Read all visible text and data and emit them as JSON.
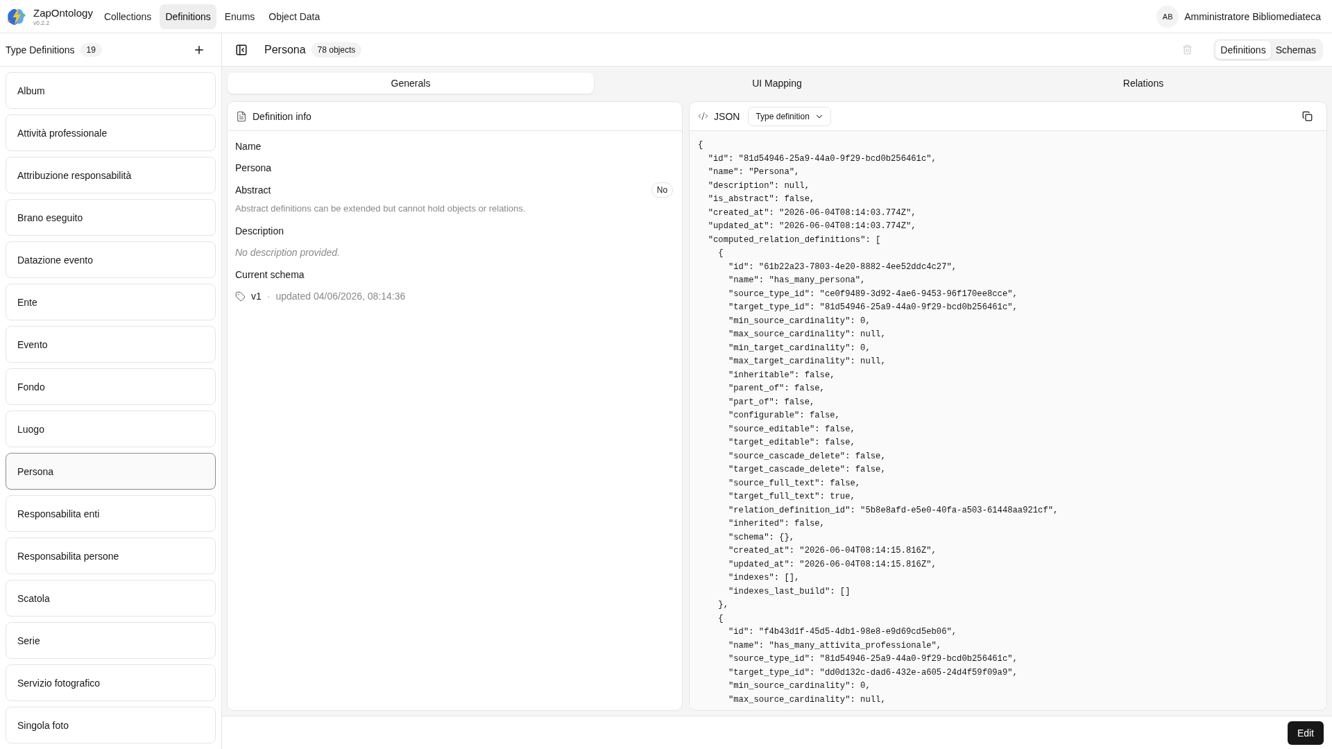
{
  "header": {
    "app_name": "ZapOntology",
    "version": "v0.2.2",
    "nav": [
      {
        "label": "Collections",
        "selected": false
      },
      {
        "label": "Definitions",
        "selected": true
      },
      {
        "label": "Enums",
        "selected": false
      },
      {
        "label": "Object Data",
        "selected": false
      }
    ],
    "user": {
      "initials": "AB",
      "name": "Amministratore Bibliomediateca"
    }
  },
  "sidebar": {
    "title": "Type Definitions",
    "count": "19",
    "items": [
      {
        "label": "Album",
        "selected": false
      },
      {
        "label": "Attività professionale",
        "selected": false
      },
      {
        "label": "Attribuzione responsabilità",
        "selected": false
      },
      {
        "label": "Brano eseguito",
        "selected": false
      },
      {
        "label": "Datazione evento",
        "selected": false
      },
      {
        "label": "Ente",
        "selected": false
      },
      {
        "label": "Evento",
        "selected": false
      },
      {
        "label": "Fondo",
        "selected": false
      },
      {
        "label": "Luogo",
        "selected": false
      },
      {
        "label": "Persona",
        "selected": true
      },
      {
        "label": "Responsabilita enti",
        "selected": false
      },
      {
        "label": "Responsabilita persone",
        "selected": false
      },
      {
        "label": "Scatola",
        "selected": false
      },
      {
        "label": "Serie",
        "selected": false
      },
      {
        "label": "Servizio fotografico",
        "selected": false
      },
      {
        "label": "Singola foto",
        "selected": false
      }
    ]
  },
  "detail": {
    "title": "Persona",
    "object_count": "78 objects",
    "delete_disabled": true,
    "view_switch": [
      {
        "label": "Definitions",
        "selected": true
      },
      {
        "label": "Schemas",
        "selected": false
      }
    ],
    "tabs": [
      {
        "label": "Generals",
        "selected": true
      },
      {
        "label": "UI Mapping",
        "selected": false
      },
      {
        "label": "Relations",
        "selected": false
      }
    ]
  },
  "definition_info": {
    "title": "Definition info",
    "name_label": "Name",
    "name_value": "Persona",
    "abstract_label": "Abstract",
    "abstract_value": "No",
    "abstract_help": "Abstract definitions can be extended but cannot hold objects or relations.",
    "description_label": "Description",
    "description_empty": "No description provided.",
    "schema_label": "Current schema",
    "schema_version": "v1",
    "schema_separator": "·",
    "schema_updated": "updated 04/06/2026, 08:14:36"
  },
  "json_panel": {
    "title": "JSON",
    "format": "Type definition",
    "lines": [
      "{",
      "  \"id\": \"81d54946-25a9-44a0-9f29-bcd0b256461c\",",
      "  \"name\": \"Persona\",",
      "  \"description\": null,",
      "  \"is_abstract\": false,",
      "  \"created_at\": \"2026-06-04T08:14:03.774Z\",",
      "  \"updated_at\": \"2026-06-04T08:14:03.774Z\",",
      "  \"computed_relation_definitions\": [",
      "    {",
      "      \"id\": \"61b22a23-7803-4e20-8882-4ee52ddc4c27\",",
      "      \"name\": \"has_many_persona\",",
      "      \"source_type_id\": \"ce0f9489-3d92-4ae6-9453-96f170ee8cce\",",
      "      \"target_type_id\": \"81d54946-25a9-44a0-9f29-bcd0b256461c\",",
      "      \"min_source_cardinality\": 0,",
      "      \"max_source_cardinality\": null,",
      "      \"min_target_cardinality\": 0,",
      "      \"max_target_cardinality\": null,",
      "      \"inheritable\": false,",
      "      \"parent_of\": false,",
      "      \"part_of\": false,",
      "      \"configurable\": false,",
      "      \"source_editable\": false,",
      "      \"target_editable\": false,",
      "      \"source_cascade_delete\": false,",
      "      \"target_cascade_delete\": false,",
      "      \"source_full_text\": false,",
      "      \"target_full_text\": true,",
      "      \"relation_definition_id\": \"5b8e8afd-e5e0-40fa-a503-61448aa921cf\",",
      "      \"inherited\": false,",
      "      \"schema\": {},",
      "      \"created_at\": \"2026-06-04T08:14:15.816Z\",",
      "      \"updated_at\": \"2026-06-04T08:14:15.816Z\",",
      "      \"indexes\": [],",
      "      \"indexes_last_build\": []",
      "    },",
      "    {",
      "      \"id\": \"f4b43d1f-45d5-4db1-98e8-e9d69cd5eb06\",",
      "      \"name\": \"has_many_attivita_professionale\",",
      "      \"source_type_id\": \"81d54946-25a9-44a0-9f29-bcd0b256461c\",",
      "      \"target_type_id\": \"dd0d132c-dad6-432e-a605-24d4f59f09a9\",",
      "      \"min_source_cardinality\": 0,",
      "      \"max_source_cardinality\": null,"
    ]
  },
  "footer": {
    "buttons": [
      "Edit"
    ]
  }
}
